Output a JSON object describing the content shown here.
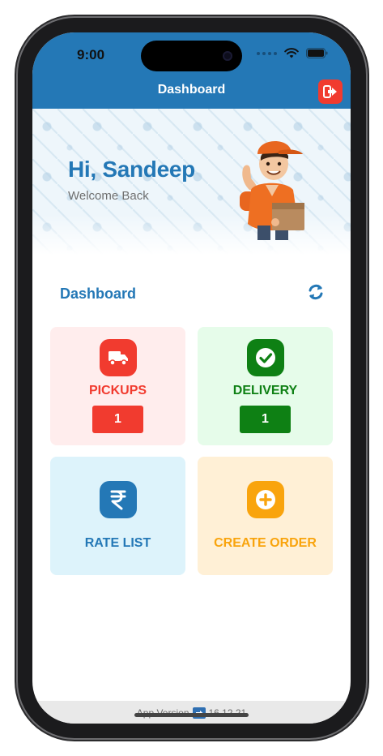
{
  "status_bar": {
    "time": "9:00"
  },
  "header": {
    "title": "Dashboard"
  },
  "hero": {
    "greeting": "Hi, Sandeep",
    "subtitle": "Welcome Back"
  },
  "section": {
    "title": "Dashboard"
  },
  "tiles": [
    {
      "label": "PICKUPS",
      "count": "1",
      "icon": "truck-icon",
      "bg": "#ffeded",
      "accent": "#f13b2f"
    },
    {
      "label": "DELIVERY",
      "count": "1",
      "icon": "check-circle-icon",
      "bg": "#e6fcea",
      "accent": "#0e8014"
    },
    {
      "label": "RATE LIST",
      "icon": "rupee-icon",
      "bg": "#ddf3fb",
      "accent": "#2478b6"
    },
    {
      "label": "CREATE ORDER",
      "icon": "plus-circle-icon",
      "bg": "#fff0d6",
      "accent": "#f9a40d"
    }
  ],
  "footer": {
    "label": "App Version",
    "version": "16.12.21"
  },
  "colors": {
    "primary": "#2478b6",
    "danger": "#f13b2f",
    "success": "#0e8014",
    "warning": "#f9a40d"
  }
}
